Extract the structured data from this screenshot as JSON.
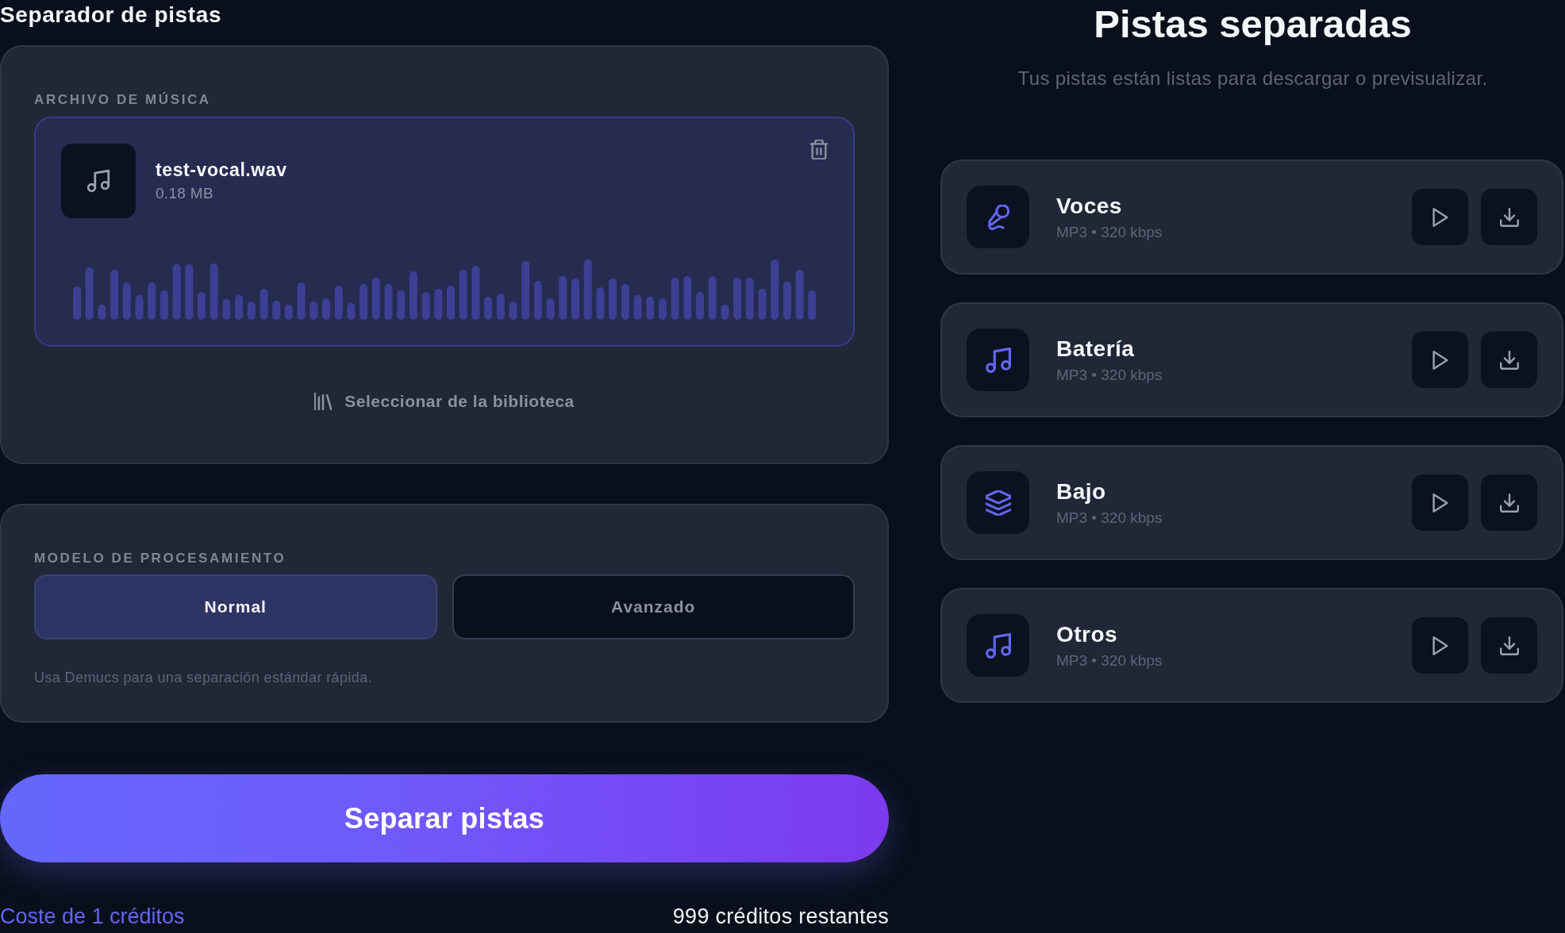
{
  "header": {
    "title": "Separador de pistas"
  },
  "file_section": {
    "label": "ARCHIVO DE MÚSICA",
    "file": {
      "name": "test-vocal.wav",
      "size": "0.18 MB"
    },
    "library_link": "Seleccionar de la biblioteca"
  },
  "model_section": {
    "label": "MODELO DE PROCESAMIENTO",
    "options": [
      {
        "label": "Normal",
        "selected": true
      },
      {
        "label": "Avanzado",
        "selected": false
      }
    ],
    "hint": "Usa Demucs para una separación estándar rápida."
  },
  "primary_button": "Separar pistas",
  "footer": {
    "cost": "Coste de 1 créditos",
    "balance": "999 créditos restantes"
  },
  "results": {
    "title": "Pistas separadas",
    "subtitle": "Tus pistas están listas para descargar o previsualizar.",
    "tracks": [
      {
        "name": "Voces",
        "format": "MP3 • 320 kbps",
        "kind": "vocals"
      },
      {
        "name": "Batería",
        "format": "MP3 • 320 kbps",
        "kind": "drums"
      },
      {
        "name": "Bajo",
        "format": "MP3 • 320 kbps",
        "kind": "bass"
      },
      {
        "name": "Otros",
        "format": "MP3 • 320 kbps",
        "kind": "other"
      }
    ]
  }
}
